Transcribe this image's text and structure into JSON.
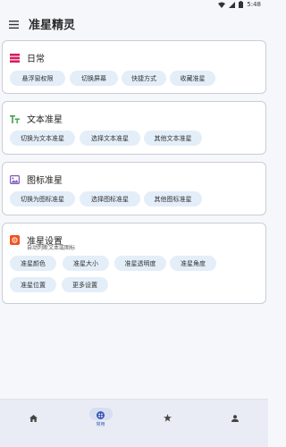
{
  "status_bar": {
    "time": "5:48"
  },
  "app_bar": {
    "title": "准星精灵"
  },
  "sections": {
    "daily": {
      "title": "日常",
      "buttons": [
        "悬浮窗权限",
        "切换屏幕",
        "快捷方式",
        "收藏准星"
      ]
    },
    "text_crosshair": {
      "title": "文本准星",
      "buttons": [
        "切换为文本准星",
        "选择文本准星",
        "其他文本准星"
      ]
    },
    "icon_crosshair": {
      "title": "图标准星",
      "buttons": [
        "切换为图标准星",
        "选择图标准星",
        "其他图标准星"
      ]
    },
    "crosshair_settings": {
      "title": "准星设置",
      "subtitle": "自动判断文本或图标",
      "buttons": [
        "准星颜色",
        "准星大小",
        "准星透明度",
        "准星角度",
        "准星位置",
        "更多设置"
      ]
    }
  },
  "bottom_nav": {
    "items": [
      {
        "icon": "home-icon",
        "label": ""
      },
      {
        "icon": "crosshair-app-icon",
        "label": "常用",
        "active": true
      },
      {
        "icon": "star-icon",
        "label": ""
      },
      {
        "icon": "person-icon",
        "label": ""
      }
    ]
  },
  "colors": {
    "accent": "#3a5bb8",
    "chip_bg": "#e3eef9",
    "daily_icon": "#d81b60",
    "text_icon": "#43a047",
    "image_icon": "#7e57c2",
    "settings_icon": "#f4511e"
  }
}
